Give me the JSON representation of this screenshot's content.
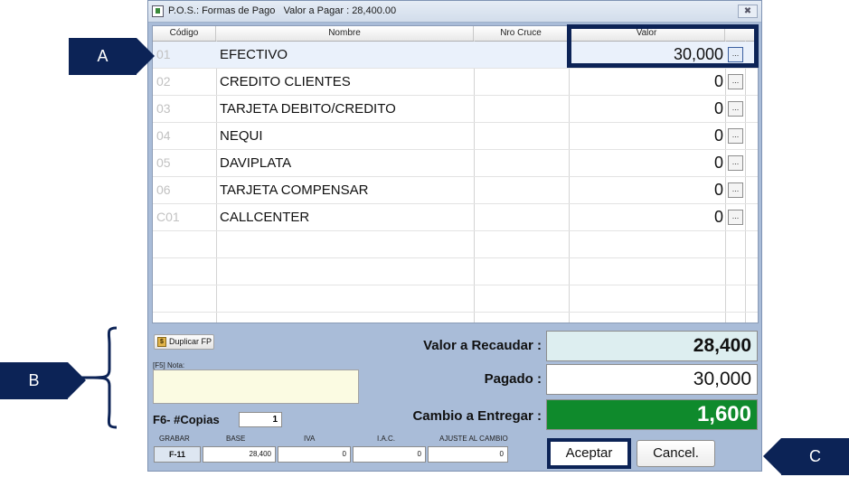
{
  "window": {
    "title": "P.O.S.: Formas de Pago   Valor a Pagar : 28,400.00",
    "close_label": "✖"
  },
  "grid": {
    "headers": {
      "codigo": "Código",
      "nombre": "Nombre",
      "cruce": "Nro Cruce",
      "valor": "Valor"
    },
    "rows": [
      {
        "code": "01",
        "name": "EFECTIVO",
        "value": "30,000",
        "btn": "..."
      },
      {
        "code": "02",
        "name": "CREDITO CLIENTES",
        "value": "0",
        "btn": "..."
      },
      {
        "code": "03",
        "name": "TARJETA DEBITO/CREDITO",
        "value": "0",
        "btn": "..."
      },
      {
        "code": "04",
        "name": "NEQUI",
        "value": "0",
        "btn": "..."
      },
      {
        "code": "05",
        "name": "DAVIPLATA",
        "value": "0",
        "btn": "..."
      },
      {
        "code": "06",
        "name": "TARJETA COMPENSAR",
        "value": "0",
        "btn": "..."
      },
      {
        "code": "C01",
        "name": "CALLCENTER",
        "value": "0",
        "btn": "..."
      }
    ]
  },
  "left_panel": {
    "duplicar_label": "Duplicar FP",
    "duplicar_icon": "$",
    "nota_label": "[F5] Nota:",
    "copias_label": "F6- #Copias",
    "copias_value": "1"
  },
  "summary": {
    "recaudar_label": "Valor a Recaudar :",
    "recaudar_value": "28,400",
    "pagado_label": "Pagado  :",
    "pagado_value": "30,000",
    "cambio_label": "Cambio a Entregar :",
    "cambio_value": "1,600"
  },
  "bottom": {
    "grabar_label": "GRABAR",
    "grabar_key": "F-11",
    "base_label": "BASE",
    "base_value": "28,400",
    "iva_label": "IVA",
    "iva_value": "0",
    "iac_label": "I.A.C.",
    "iac_value": "0",
    "ajuste_label": "AJUSTE AL CAMBIO",
    "ajuste_value": "0"
  },
  "buttons": {
    "aceptar": "Aceptar",
    "cancelar": "Cancel."
  },
  "callouts": {
    "a": "A",
    "b": "B",
    "c": "C"
  },
  "colors": {
    "callout": "#0c2356",
    "cambio_bg": "#0f8a2c",
    "window_bg": "#a9bcd8"
  }
}
